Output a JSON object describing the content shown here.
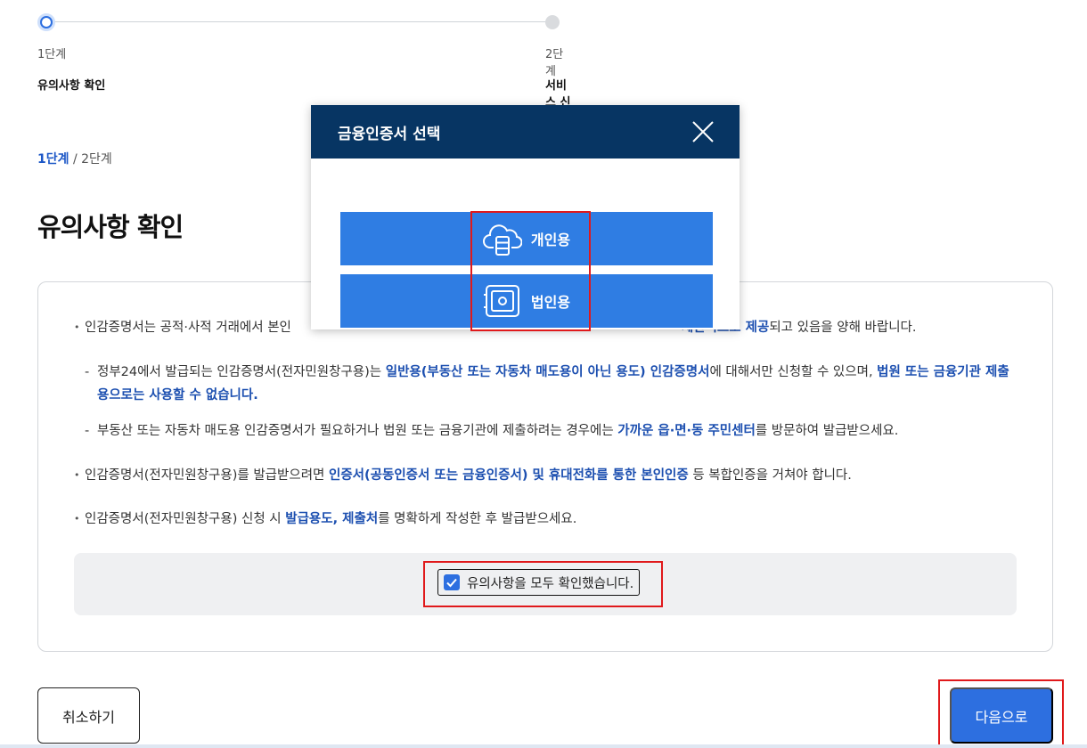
{
  "stepper": {
    "step1": {
      "num": "1단계",
      "name": "유의사항 확인"
    },
    "step2": {
      "num": "2단계",
      "name": "서비스 신청"
    }
  },
  "breadcrumb": {
    "current": "1단계",
    "sep": " / ",
    "next": "2단계"
  },
  "page_title": "유의사항 확인",
  "notices": {
    "n1_pre": "인감증명서는 공적·사적 거래에서 본인",
    "n1_hl": "제한적으로 제공",
    "n1_post": "되고 있음을 양해 바랍니다.",
    "s1_pre": "정부24에서 발급되는 인감증명서(전자민원창구용)는 ",
    "s1_hl1": "일반용(부동산 또는 자동차 매도용이 아닌 용도) 인감증명서",
    "s1_mid": "에 대해서만 신청할 수 있으며, ",
    "s1_hl2": "법원 또는 금융기관 제출용으로는 사용할 수 없습니다.",
    "s2_pre": "부동산 또는 자동차 매도용 인감증명서가 필요하거나 법원 또는 금융기관에 제출하려는 경우에는 ",
    "s2_hl": "가까운 읍·면·동 주민센터",
    "s2_post": "를 방문하여 발급받으세요.",
    "n2_pre": "인감증명서(전자민원창구용)를 발급받으려면 ",
    "n2_hl": "인증서(공동인증서 또는 금융인증서) 및 휴대전화를 통한 본인인증",
    "n2_post": " 등 복합인증을 거쳐야 합니다.",
    "n3_pre": "인감증명서(전자민원창구용) 신청 시 ",
    "n3_hl": "발급용도, 제출처",
    "n3_post": "를 명확하게 작성한 후 발급받으세요."
  },
  "confirm": {
    "label": "유의사항을 모두 확인했습니다.",
    "checked": true
  },
  "buttons": {
    "cancel": "취소하기",
    "next": "다음으로"
  },
  "modal": {
    "title": "금융인증서 선택",
    "personal": "개인용",
    "corporate": "법인용",
    "personal_icon": "cloud-server-icon",
    "corporate_icon": "safe-icon"
  },
  "colors": {
    "primary": "#2d6fe0",
    "modal_header": "#073563",
    "highlight_text": "#1c4fb0",
    "annotation_red": "#e0191b"
  }
}
